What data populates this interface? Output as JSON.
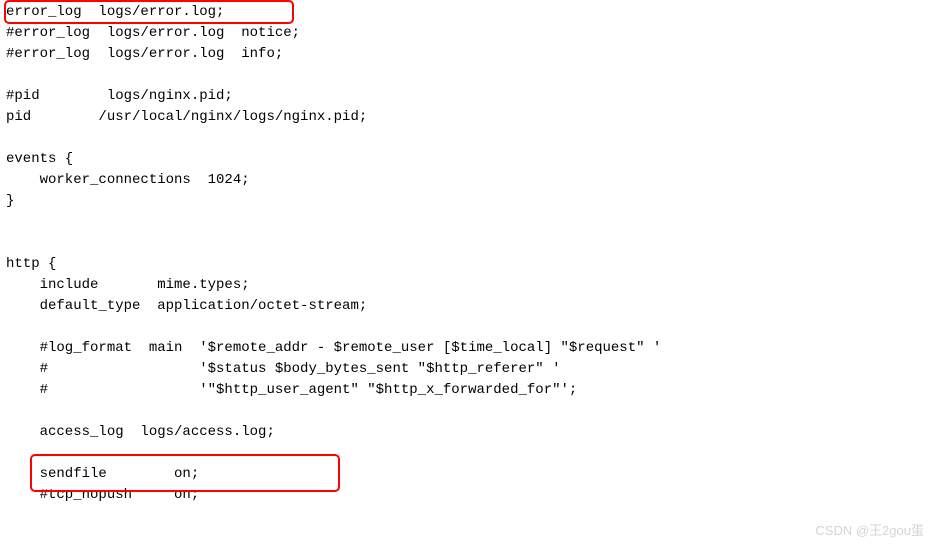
{
  "lines": {
    "l1": "error_log  logs/error.log;",
    "l2": "#error_log  logs/error.log  notice;",
    "l3": "#error_log  logs/error.log  info;",
    "l4": "",
    "l5": "#pid        logs/nginx.pid;",
    "l6": "pid        /usr/local/nginx/logs/nginx.pid;",
    "l7": "",
    "l8": "events {",
    "l9": "    worker_connections  1024;",
    "l10": "}",
    "l11": "",
    "l12": "",
    "l13": "http {",
    "l14": "    include       mime.types;",
    "l15": "    default_type  application/octet-stream;",
    "l16": "",
    "l17": "    #log_format  main  '$remote_addr - $remote_user [$time_local] \"$request\" '",
    "l18": "    #                  '$status $body_bytes_sent \"$http_referer\" '",
    "l19": "    #                  '\"$http_user_agent\" \"$http_x_forwarded_for\"';",
    "l20": "",
    "l21": "    access_log  logs/access.log;",
    "l22": "",
    "l23": "    sendfile        on;",
    "l24": "    #tcp_nopush     on;"
  },
  "watermark": "CSDN @王2gou蛋"
}
